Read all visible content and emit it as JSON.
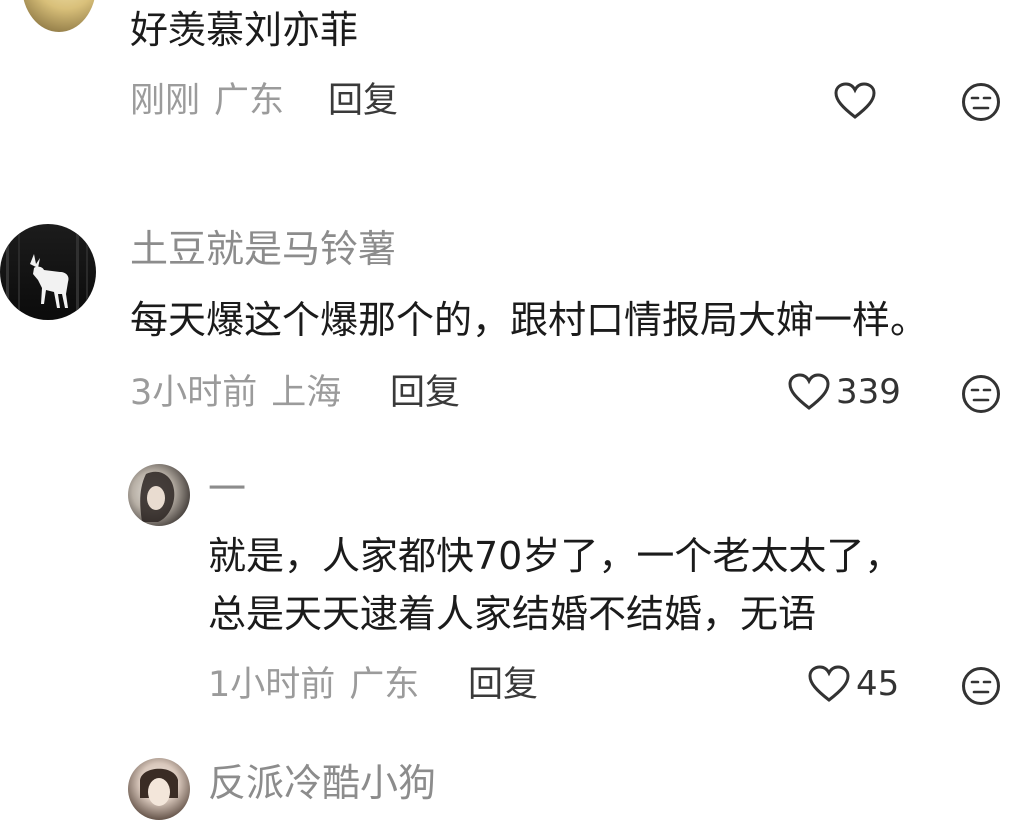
{
  "comments": [
    {
      "content": "好羡慕刘亦菲",
      "time": "刚刚",
      "location": "广东",
      "reply_label": "回复",
      "likes": ""
    },
    {
      "username": "土豆就是马铃薯",
      "content": "每天爆这个爆那个的，跟村口情报局大婶一样。",
      "time": "3小时前",
      "location": "上海",
      "reply_label": "回复",
      "likes": "339"
    },
    {
      "username": "一",
      "content_lines": [
        "就是，人家都快70岁了，一个老太太了，",
        "总是天天逮着人家结婚不结婚，无语"
      ],
      "time": "1小时前",
      "location": "广东",
      "reply_label": "回复",
      "likes": "45"
    },
    {
      "username": "反派冷酷小狗"
    }
  ],
  "icons": {
    "like": "heart-outline-icon",
    "dislike": "meh-face-icon"
  }
}
